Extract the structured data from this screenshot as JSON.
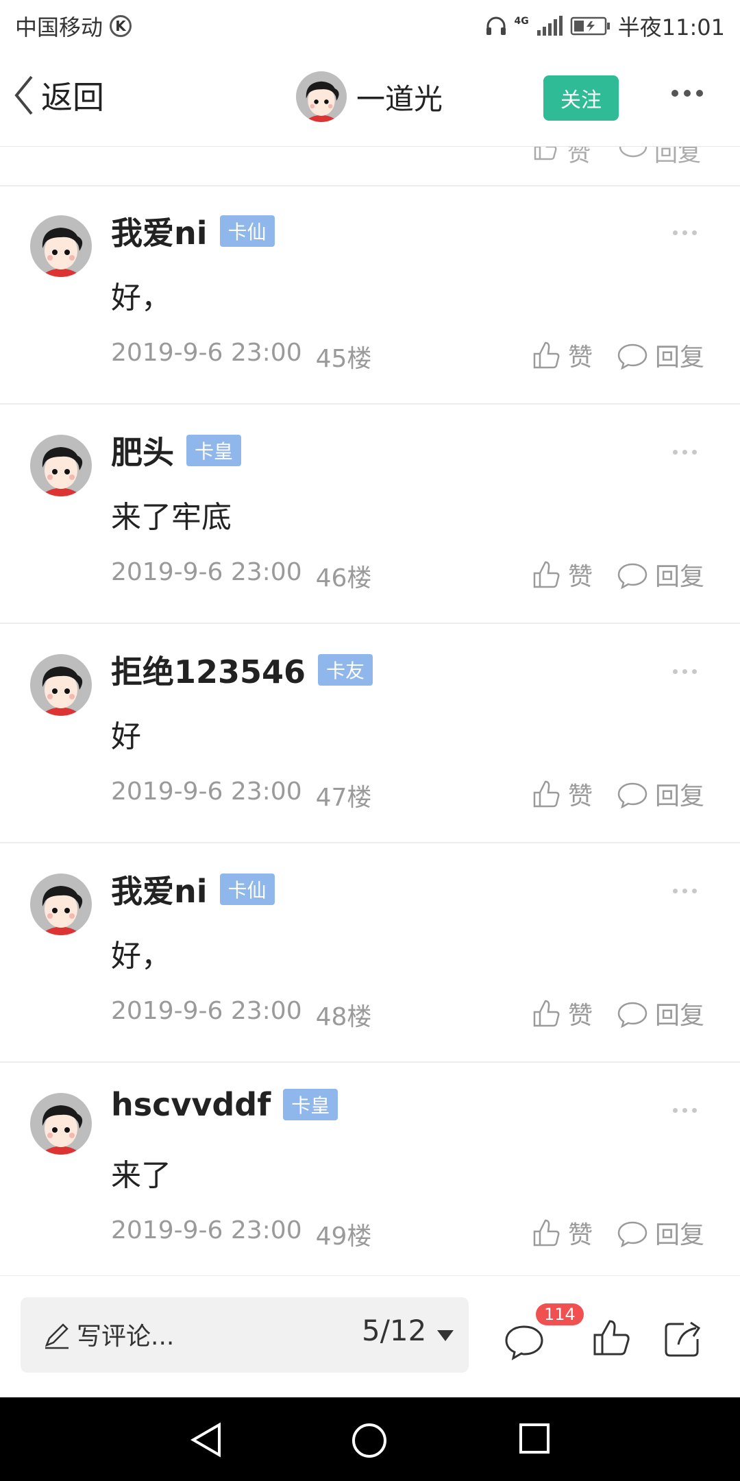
{
  "status_bar": {
    "carrier": "中国移动",
    "carrier_badge": "K",
    "network": "4G",
    "time": "半夜11:01"
  },
  "header": {
    "back_label": "返回",
    "username": "一道光",
    "follow_label": "关注"
  },
  "partial_row": {
    "like_label": "赞",
    "reply_label": "回复"
  },
  "comments": [
    {
      "name": "我爱ni",
      "level": "卡仙",
      "text": "好，",
      "time": "2019-9-6 23:00",
      "floor": "45楼",
      "like_label": "赞",
      "reply_label": "回复"
    },
    {
      "name": "肥头",
      "level": "卡皇",
      "text": "来了牢底",
      "time": "2019-9-6 23:00",
      "floor": "46楼",
      "like_label": "赞",
      "reply_label": "回复"
    },
    {
      "name": "拒绝123546",
      "level": "卡友",
      "text": "好",
      "time": "2019-9-6 23:00",
      "floor": "47楼",
      "like_label": "赞",
      "reply_label": "回复"
    },
    {
      "name": "我爱ni",
      "level": "卡仙",
      "text": "好，",
      "time": "2019-9-6 23:00",
      "floor": "48楼",
      "like_label": "赞",
      "reply_label": "回复"
    },
    {
      "name": "hscvvddf",
      "level": "卡皇",
      "text": "来了",
      "time": "2019-9-6 23:00",
      "floor": "49楼",
      "like_label": "赞",
      "reply_label": "回复"
    }
  ],
  "bottom_bar": {
    "write_placeholder": "写评论...",
    "pager": "5/12",
    "comment_count": "114"
  },
  "colors": {
    "accent": "#2fbb96",
    "level_badge": "#90b7eb",
    "count_badge": "#f05050"
  }
}
